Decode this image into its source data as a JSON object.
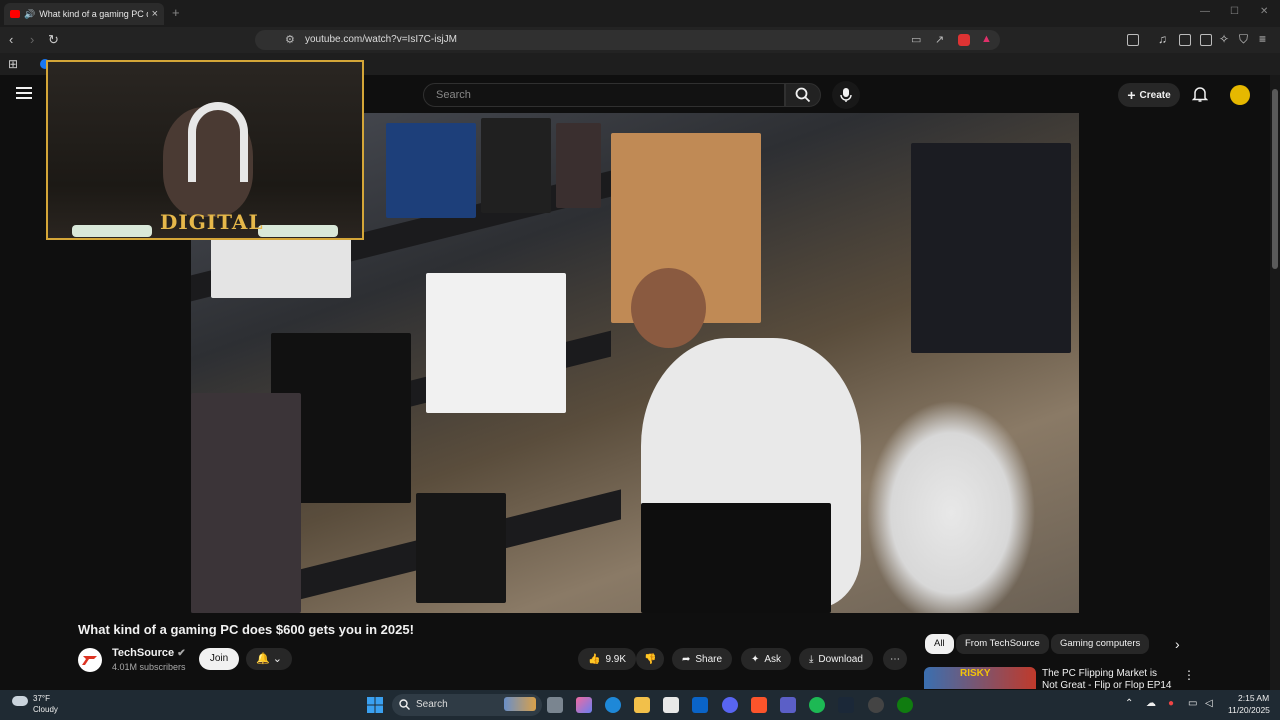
{
  "browser": {
    "tab_title": "What kind of a gaming PC does $600 gets you in 2025!",
    "url": "youtube.com/watch?v=IsI7C-isjJM"
  },
  "youtube": {
    "search_placeholder": "Search",
    "create_label": "Create",
    "video": {
      "title": "What kind of a gaming PC does $600 gets you in 2025!",
      "channel": "TechSource",
      "subscribers": "4.01M subscribers",
      "join_label": "Join",
      "likes": "9.9K",
      "share_label": "Share",
      "ask_label": "Ask",
      "download_label": "Download"
    },
    "chips": [
      "All",
      "From TechSource",
      "Gaming computers"
    ],
    "recommended": {
      "thumb_text": "RISKY",
      "title": "The PC Flipping Market is Not Great - Flip or Flop EP14"
    }
  },
  "webcam": {
    "overlay_text": "DIGITAL"
  },
  "taskbar": {
    "weather_temp": "37°F",
    "weather_desc": "Cloudy",
    "search_label": "Search",
    "time": "2:15 AM",
    "date": "11/20/2025"
  },
  "colors": {
    "yt_red": "#ff0000",
    "webcam_border": "#d4a638",
    "taskbar": "#1f2a33"
  }
}
